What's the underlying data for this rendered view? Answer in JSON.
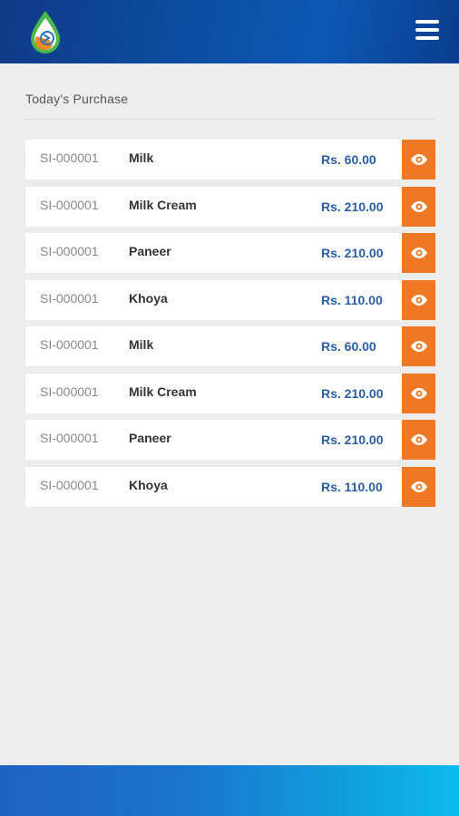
{
  "header": {
    "logo_icon": "water-drop-logo",
    "menu_icon": "hamburger-menu-icon",
    "colors": {
      "primary": "#0b4fa3",
      "accent": "#ee7824"
    }
  },
  "section": {
    "title": "Today's Purchase"
  },
  "purchases": [
    {
      "code": "SI-000001",
      "item": "Milk",
      "price": "Rs. 60.00"
    },
    {
      "code": "SI-000001",
      "item": "Milk Cream",
      "price": "Rs. 210.00"
    },
    {
      "code": "SI-000001",
      "item": "Paneer",
      "price": "Rs. 210.00"
    },
    {
      "code": "SI-000001",
      "item": "Khoya",
      "price": "Rs. 110.00"
    },
    {
      "code": "SI-000001",
      "item": "Milk",
      "price": "Rs. 60.00"
    },
    {
      "code": "SI-000001",
      "item": "Milk Cream",
      "price": "Rs. 210.00"
    },
    {
      "code": "SI-000001",
      "item": "Paneer",
      "price": "Rs. 210.00"
    },
    {
      "code": "SI-000001",
      "item": "Khoya",
      "price": "Rs. 110.00"
    }
  ],
  "row_action_icon": "eye-icon"
}
